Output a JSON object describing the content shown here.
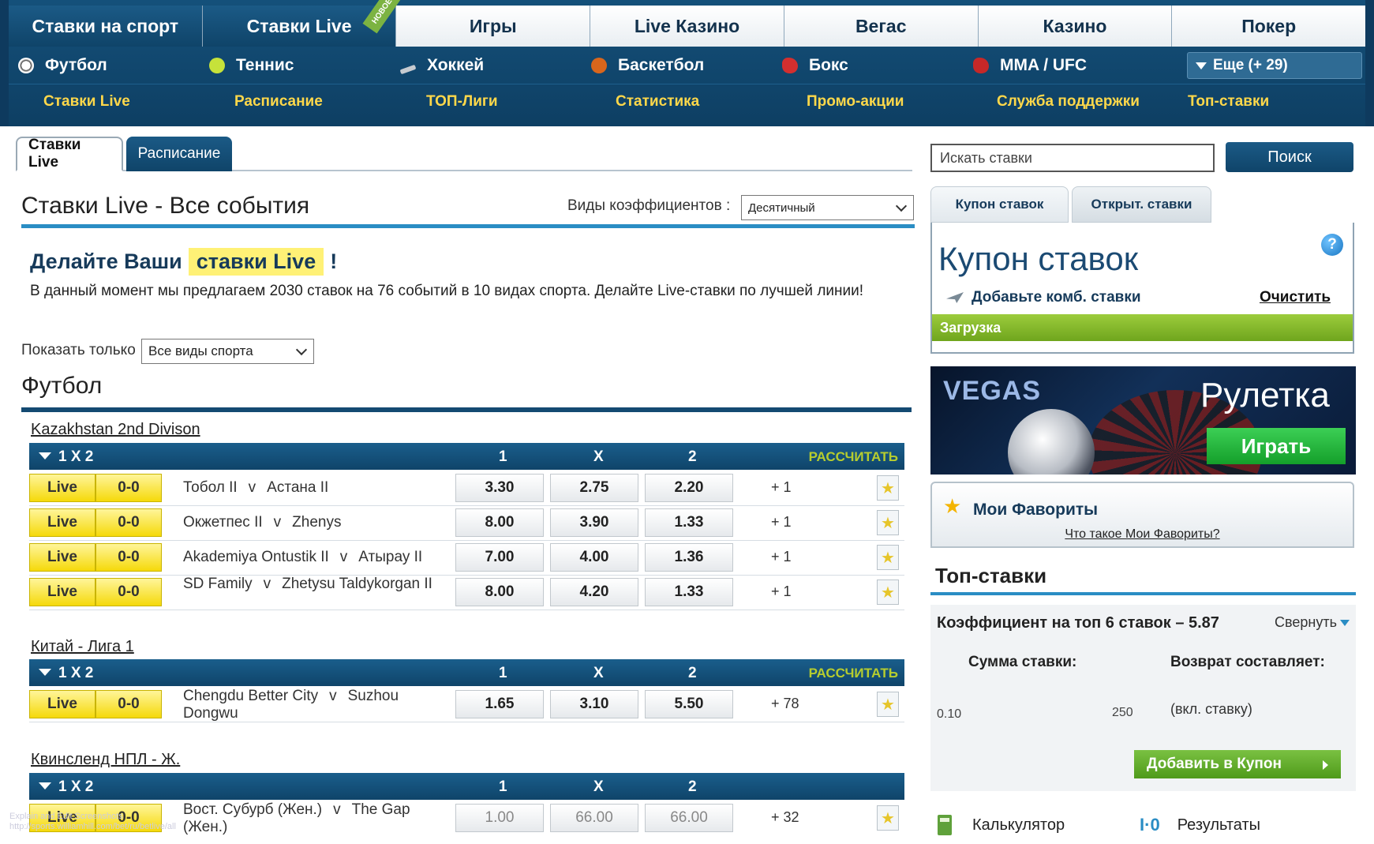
{
  "nav": {
    "main_tabs": [
      "Ставки на спорт",
      "Ставки Live",
      "Игры",
      "Live Казино",
      "Вегас",
      "Казино",
      "Покер"
    ],
    "new_badge": "НОВОЕ",
    "sports": [
      "Футбол",
      "Теннис",
      "Хоккей",
      "Баскетбол",
      "Бокс",
      "MMA / UFC"
    ],
    "more": "Еще (+ 29)",
    "links": [
      "Ставки Live",
      "Расписание",
      "ТОП-Лиги",
      "Статистика",
      "Промо-акции",
      "Служба поддержки",
      "Топ-ставки"
    ]
  },
  "subtabs": [
    "Ставки Live",
    "Расписание"
  ],
  "page": {
    "title": "Ставки Live - Все события",
    "odds_label": "Виды коэффициентов :",
    "odds_value": "Десятичный",
    "promo_pre": "Делайте Ваши",
    "promo_hl": "ставки Live",
    "promo_post": "!",
    "promo_text": "В данный момент мы предлагаем 2030 ставок на 76 событий в 10 видах спорта. Делайте Live-ставки по лучшей линии!",
    "show_only_label": "Показать только",
    "show_only_value": "Все виды спорта",
    "section": "Футбол"
  },
  "market": {
    "name": "1 X 2",
    "c1": "1",
    "cx": "X",
    "c2": "2",
    "calc": "РАССЧИТАТЬ",
    "live": "Live",
    "v": "v"
  },
  "leagues": [
    {
      "name": "Kazakhstan 2nd Divison",
      "matches": [
        {
          "score": "0-0",
          "home": "Тобол II",
          "away": "Астана II",
          "o1": "3.30",
          "ox": "2.75",
          "o2": "2.20",
          "more": "+ 1"
        },
        {
          "score": "0-0",
          "home": "Окжетпес II",
          "away": "Zhenys",
          "o1": "8.00",
          "ox": "3.90",
          "o2": "1.33",
          "more": "+ 1"
        },
        {
          "score": "0-0",
          "home": "Akademiya Ontustik II",
          "away": "Атырау II",
          "o1": "7.00",
          "ox": "4.00",
          "o2": "1.36",
          "more": "+ 1"
        },
        {
          "score": "0-0",
          "home": "SD Family",
          "away": "Zhetysu Taldykorgan II",
          "o1": "8.00",
          "ox": "4.20",
          "o2": "1.33",
          "more": "+ 1"
        }
      ]
    },
    {
      "name": "Китай - Лига 1",
      "matches": [
        {
          "score": "0-0",
          "home": "Chengdu Better City",
          "away": "Suzhou Dongwu",
          "o1": "1.65",
          "ox": "3.10",
          "o2": "5.50",
          "more": "+ 78"
        }
      ]
    },
    {
      "name": "Квинсленд НПЛ - Ж.",
      "matches": [
        {
          "score": "0-0",
          "home": "Вост. Субурб (Жен.)",
          "away": "The Gap (Жен.)",
          "o1": "1.00",
          "ox": "66.00",
          "o2": "66.00",
          "more": "+ 32"
        }
      ]
    }
  ],
  "watermark": [
    "Explain and Edit Screenshots",
    "http://sports.williamhill.com/bet/ru/betlive/all"
  ],
  "sidebar": {
    "search_placeholder": "Искать ставки",
    "search_button": "Поиск",
    "tabs": [
      "Купон ставок",
      "Открыт. ставки"
    ],
    "coupon_title": "Купон ставок",
    "help": "?",
    "add_combo": "Добавьте комб. ставки",
    "clear": "Очистить",
    "loading": "Загрузка",
    "banner_vegas": "VEGAS",
    "banner_title": "Рулетка",
    "banner_play": "Играть",
    "fav_title": "Мои Фавориты",
    "fav_link": "Что такое Мои Фавориты?",
    "top_title": "Топ-ставки",
    "coef": "Коэффициент на топ 6 ставок – 5.87",
    "collapse": "Свернуть",
    "stake_label": "Сумма ставки:",
    "return_label": "Возврат составляет:",
    "stake": "0.10",
    "return_value": "250",
    "incl": "(вкл. ставку)",
    "add_coupon": "Добавить в Купон",
    "calculator": "Калькулятор",
    "results": "Результаты"
  },
  "colors": {
    "nav": "#0f4469",
    "accent": "#2a8dc4",
    "live": "#f5d90a",
    "green": "#6fa51d",
    "link_yellow": "#ffd84a"
  }
}
